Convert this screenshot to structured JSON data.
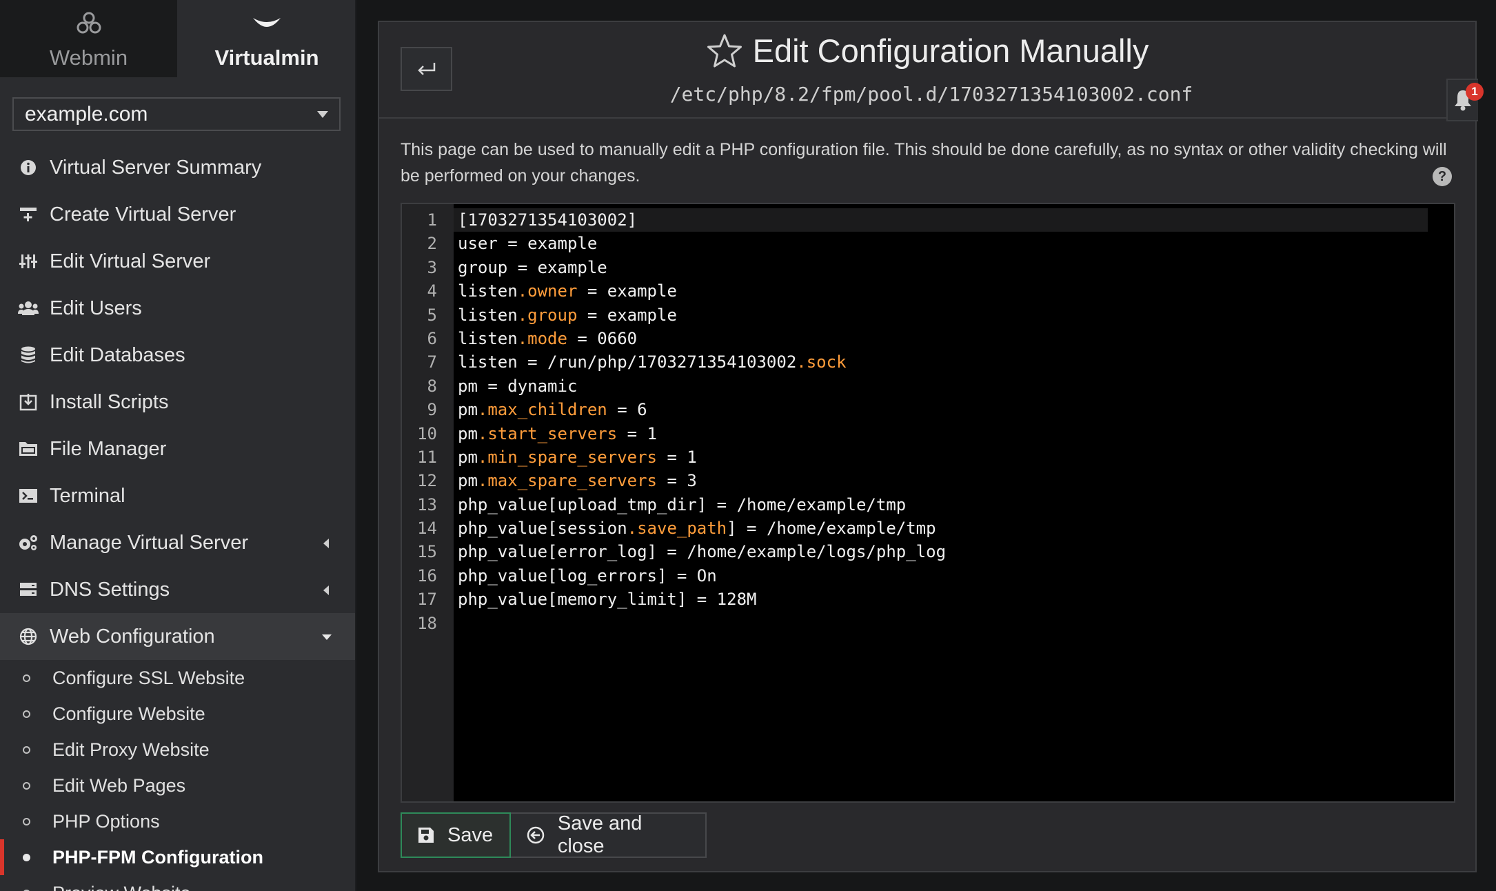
{
  "switcher": {
    "webmin_label": "Webmin",
    "virtualmin_label": "Virtualmin"
  },
  "domain_select": {
    "value": "example.com"
  },
  "menu": {
    "items": [
      {
        "label": "Virtual Server Summary",
        "icon": "info-circle-icon"
      },
      {
        "label": "Create Virtual Server",
        "icon": "server-plus-icon"
      },
      {
        "label": "Edit Virtual Server",
        "icon": "sliders-icon"
      },
      {
        "label": "Edit Users",
        "icon": "users-icon"
      },
      {
        "label": "Edit Databases",
        "icon": "database-icon"
      },
      {
        "label": "Install Scripts",
        "icon": "download-box-icon"
      },
      {
        "label": "File Manager",
        "icon": "folder-icon"
      },
      {
        "label": "Terminal",
        "icon": "terminal-icon"
      },
      {
        "label": "Manage Virtual Server",
        "icon": "gears-icon"
      },
      {
        "label": "DNS Settings",
        "icon": "dns-server-icon"
      },
      {
        "label": "Web Configuration",
        "icon": "globe-icon"
      }
    ],
    "web_submenu": [
      {
        "label": "Configure SSL Website"
      },
      {
        "label": "Configure Website"
      },
      {
        "label": "Edit Proxy Website"
      },
      {
        "label": "Edit Web Pages"
      },
      {
        "label": "PHP Options"
      },
      {
        "label": "PHP-FPM Configuration",
        "active": true
      },
      {
        "label": "Preview Website"
      }
    ]
  },
  "header": {
    "title": "Edit Configuration Manually",
    "subtitle": "/etc/php/8.2/fpm/pool.d/1703271354103002.conf",
    "notification_count": "1"
  },
  "description": "This page can be used to manually edit a PHP configuration file. This should be done carefully, as no syntax or other validity checking will be performed on your changes.",
  "help_label": "?",
  "editor": {
    "line_numbers": [
      "1",
      "2",
      "3",
      "4",
      "5",
      "6",
      "7",
      "8",
      "9",
      "10",
      "11",
      "12",
      "13",
      "14",
      "15",
      "16",
      "17",
      "18"
    ],
    "lines": [
      "[1703271354103002]",
      "user = example",
      "group = example",
      "listen.owner = example",
      "listen.group = example",
      "listen.mode = 0660",
      "listen = /run/php/1703271354103002.sock",
      "pm = dynamic",
      "pm.max_children = 6",
      "pm.start_servers = 1",
      "pm.min_spare_servers = 1",
      "pm.max_spare_servers = 3",
      "php_value[upload_tmp_dir] = /home/example/tmp",
      "php_value[session.save_path] = /home/example/tmp",
      "php_value[error_log] = /home/example/logs/php_log",
      "php_value[log_errors] = On",
      "php_value[memory_limit] = 128M",
      ""
    ]
  },
  "buttons": {
    "save_label": "Save",
    "save_close_label": "Save and close"
  },
  "colors": {
    "accent_property": "#ff9d3b",
    "save_border": "#2e8a59",
    "active_marker": "#d9352b",
    "badge": "#d9352b"
  }
}
